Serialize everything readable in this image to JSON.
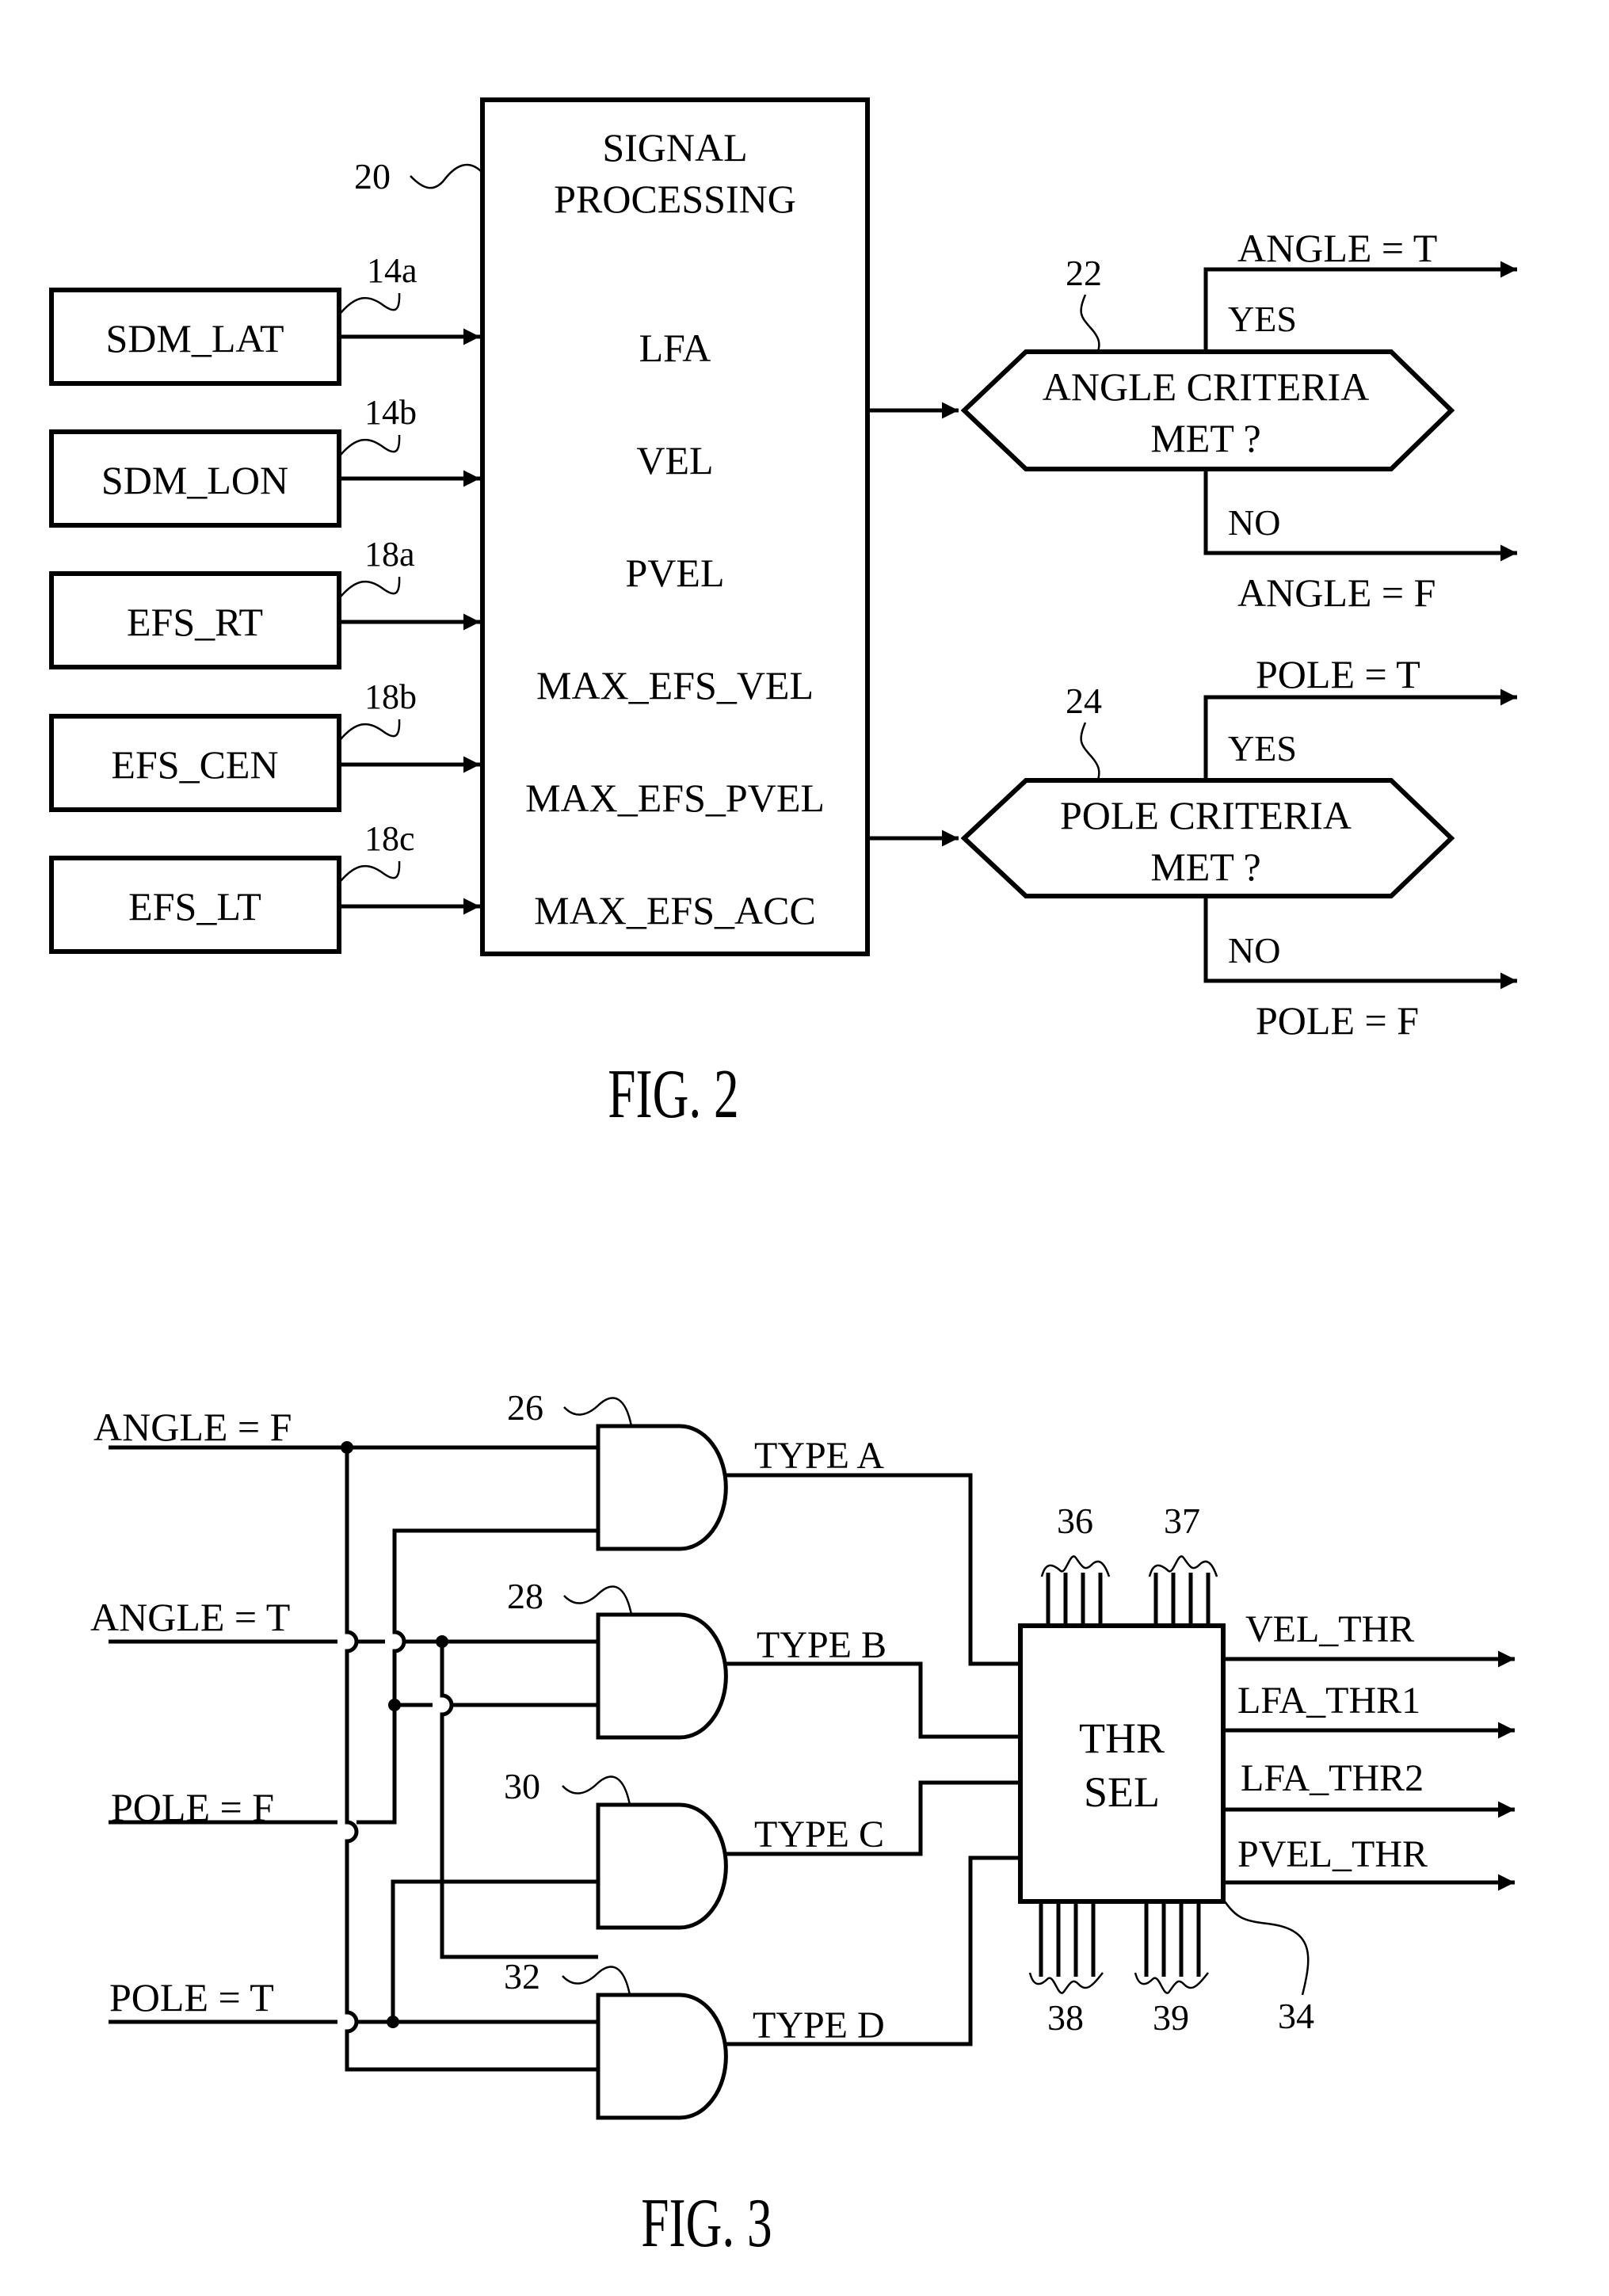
{
  "fig2": {
    "caption": "FIG. 2",
    "processor": {
      "ref": "20",
      "title_line1": "SIGNAL",
      "title_line2": "PROCESSING",
      "signals": [
        "LFA",
        "VEL",
        "PVEL",
        "MAX_EFS_VEL",
        "MAX_EFS_PVEL",
        "MAX_EFS_ACC"
      ]
    },
    "inputs": [
      {
        "label": "SDM_LAT",
        "ref": "14a"
      },
      {
        "label": "SDM_LON",
        "ref": "14b"
      },
      {
        "label": "EFS_RT",
        "ref": "18a"
      },
      {
        "label": "EFS_CEN",
        "ref": "18b"
      },
      {
        "label": "EFS_LT",
        "ref": "18c"
      }
    ],
    "decisions": [
      {
        "ref": "22",
        "line1": "ANGLE CRITERIA",
        "line2": "MET ?",
        "yes": "YES",
        "no": "NO",
        "true_out": "ANGLE = T",
        "false_out": "ANGLE = F"
      },
      {
        "ref": "24",
        "line1": "POLE CRITERIA",
        "line2": "MET ?",
        "yes": "YES",
        "no": "NO",
        "true_out": "POLE = T",
        "false_out": "POLE = F"
      }
    ]
  },
  "fig3": {
    "caption": "FIG. 3",
    "inputs": [
      "ANGLE = F",
      "ANGLE = T",
      "POLE = F",
      "POLE = T"
    ],
    "gates": [
      {
        "ref": "26",
        "output": "TYPE A"
      },
      {
        "ref": "28",
        "output": "TYPE B"
      },
      {
        "ref": "30",
        "output": "TYPE C"
      },
      {
        "ref": "32",
        "output": "TYPE D"
      }
    ],
    "selector": {
      "ref": "34",
      "line1": "THR",
      "line2": "SEL",
      "bus_top": [
        "36",
        "37"
      ],
      "bus_bottom": [
        "38",
        "39"
      ],
      "outputs": [
        "VEL_THR",
        "LFA_THR1",
        "LFA_THR2",
        "PVEL_THR"
      ]
    }
  }
}
